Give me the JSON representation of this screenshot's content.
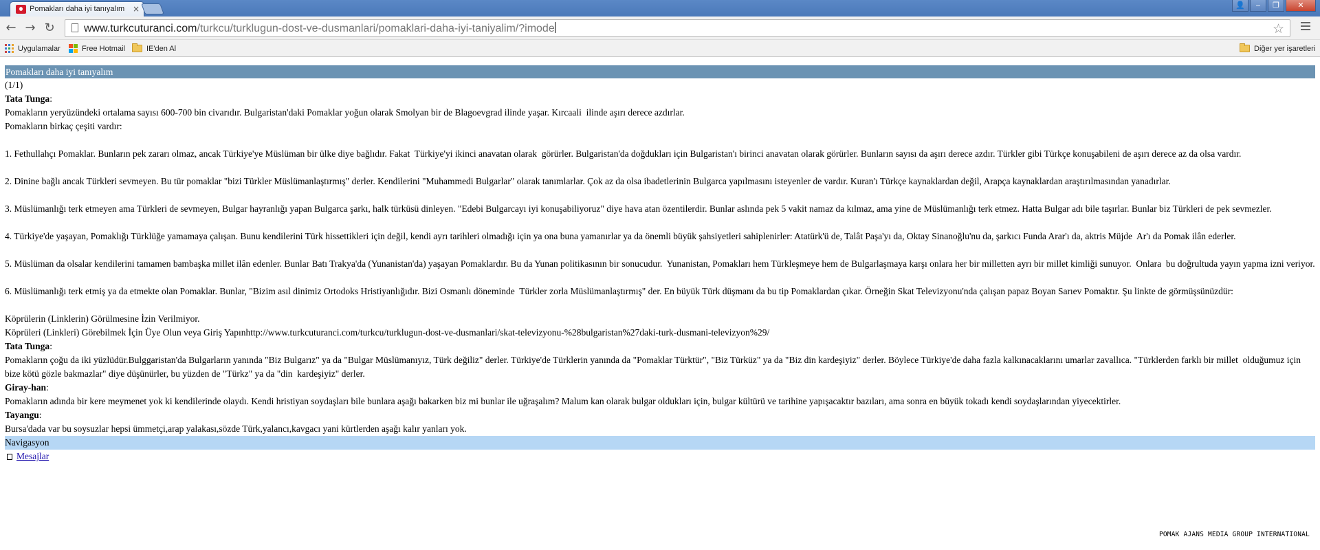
{
  "browser": {
    "tab_title": "Pomakları daha iyi tanıyalım",
    "tab_close": "×",
    "address": {
      "host": "www.turkcuturanci.com",
      "path": "/turkcu/turklugun-dost-ve-dusmanlari/pomaklari-daha-iyi-taniyalim/?imode"
    },
    "window_buttons": {
      "user": "👤",
      "minimize": "‒",
      "restore": "❐",
      "close": "✕"
    },
    "nav": {
      "back": "←",
      "forward": "→",
      "reload": "↻",
      "star": "☆"
    },
    "bookmarks": [
      {
        "label": "Uygulamalar",
        "icon": "apps-icon"
      },
      {
        "label": "Free Hotmail",
        "icon": "windows-icon"
      },
      {
        "label": "IE'den Al",
        "icon": "folder-icon"
      }
    ],
    "other_bookmarks": "Diğer yer işaretleri",
    "colors": {
      "tabbar": "#4a78b9",
      "title_bar": "#6b93b3",
      "nav_bar": "#b6d7f5",
      "favicon": "#d31a2c"
    }
  },
  "page": {
    "thread_title": "Pomakları daha iyi tanıyalım",
    "pagination": "(1/1)",
    "posts": [
      {
        "author": "Tata Tunga",
        "lines": [
          "Pomakların yeryüzündeki ortalama sayısı 600-700 bin civarıdır. Bulgaristan'daki Pomaklar yoğun olarak Smolyan bir de Blagoevgrad ilinde yaşar. Kırcaali  ilinde aşırı derece azdırlar.",
          "Pomakların birkaç çeşiti vardır:",
          "",
          "1. Fethullahçı Pomaklar. Bunların pek zararı olmaz, ancak Türkiye'ye Müslüman bir ülke diye bağlıdır. Fakat  Türkiye'yi ikinci anavatan olarak  görürler. Bulgaristan'da doğdukları için Bulgaristan'ı birinci anavatan olarak görürler. Bunların sayısı da aşırı derece azdır. Türkler gibi Türkçe konuşabileni de aşırı derece az da olsa vardır.",
          "",
          "2. Dinine bağlı ancak Türkleri sevmeyen. Bu tür pomaklar \"bizi Türkler Müslümanlaştırmış\" derler. Kendilerini \"Muhammedi Bulgarlar\" olarak tanımlarlar. Çok az da olsa ibadetlerinin Bulgarca yapılmasını isteyenler de vardır. Kuran'ı Türkçe kaynaklardan değil, Arapça kaynaklardan araştırılmasından yanadırlar.",
          "",
          "3. Müslümanlığı terk etmeyen ama Türkleri de sevmeyen, Bulgar hayranlığı yapan Bulgarca şarkı, halk türküsü dinleyen. \"Edebi Bulgarcayı iyi konuşabiliyoruz\" diye hava atan özentilerdir. Bunlar aslında pek 5 vakit namaz da kılmaz, ama yine de Müslümanlığı terk etmez. Hatta Bulgar adı bile taşırlar. Bunlar biz Türkleri de pek sevmezler.",
          "",
          "4. Türkiye'de yaşayan, Pomaklığı Türklüğe yamamaya çalışan. Bunu kendilerini Türk hissettikleri için değil, kendi ayrı tarihleri olmadığı için ya ona buna yamanırlar ya da önemli büyük şahsiyetleri sahiplenirler: Atatürk'ü de, Talât Paşa'yı da, Oktay Sinanoğlu'nu da, şarkıcı Funda Arar'ı da, aktris Müjde  Ar'ı da Pomak ilân ederler.",
          "",
          "5. Müslüman da olsalar kendilerini tamamen bambaşka millet ilân edenler. Bunlar Batı Trakya'da (Yunanistan'da) yaşayan Pomaklardır. Bu da Yunan politikasının bir sonucudur.  Yunanistan, Pomakları hem Türkleşmeye hem de Bulgarlaşmaya karşı onlara her bir milletten ayrı bir millet kimliği sunuyor.  Onlara  bu doğrultuda yayın yapma izni veriyor.",
          "",
          "6. Müslümanlığı terk etmiş ya da etmekte olan Pomaklar. Bunlar, \"Bizim asıl dinimiz Ortodoks Hristiyanlığıdır. Bizi Osmanlı döneminde  Türkler zorla Müslümanlaştırmış\" der. En büyük Türk düşmanı da bu tip Pomaklardan çıkar. Örneğin Skat Televizyonu'nda çalışan papaz Boyan Sarıev Pomaktır. Şu linkte de görmüşsünüzdür:",
          "",
          "Köprülerin (Linklerin) Görülmesine İzin Verilmiyor.",
          "Köprüleri (Linkleri) Görebilmek İçin Üye Olun veya Giriş Yapınhttp://www.turkcuturanci.com/turkcu/turklugun-dost-ve-dusmanlari/skat-televizyonu-%28bulgaristan%27daki-turk-dusmani-televizyon%29/"
        ]
      },
      {
        "author": "Tata Tunga",
        "lines": [
          "Pomakların çoğu da iki yüzlüdür.Bulggaristan'da Bulgarların yanında \"Biz Bulgarız\" ya da \"Bulgar Müslümanıyız, Türk değiliz\" derler. Türkiye'de Türklerin yanında da \"Pomaklar Türktür\", \"Biz Türküz\" ya da \"Biz din kardeşiyiz\" derler. Böylece Türkiye'de daha fazla kalkınacaklarını umarlar zavallıca. \"Türklerden farklı bir millet  olduğumuz için bize kötü gözle bakmazlar\" diye düşünürler, bu yüzden de \"Türkz\" ya da \"din  kardeşiyiz\" derler."
        ]
      },
      {
        "author": "Giray-han",
        "lines": [
          "Pomakların adında bir kere meymenet yok ki kendilerinde olaydı. Kendi hristiyan soydaşları bile bunlara aşağı bakarken biz mi bunlar ile uğraşalım? Malum kan olarak bulgar oldukları için, bulgar kültürü ve tarihine yapışacaktır bazıları, ama sonra en büyük tokadı kendi soydaşlarından yiyecektirler."
        ]
      },
      {
        "author": "Tayangu",
        "lines": [
          "Bursa'dada var bu soysuzlar hepsi ümmetçi,arap yalakası,sözde Türk,yalancı,kavgacı yani kürtlerden aşağı kalır yanları yok."
        ]
      }
    ],
    "nav_title": "Navigasyon",
    "messages_link": "Mesajlar",
    "footer_brand": "POMAK AJANS MEDIA GROUP INTERNATIONAL"
  }
}
